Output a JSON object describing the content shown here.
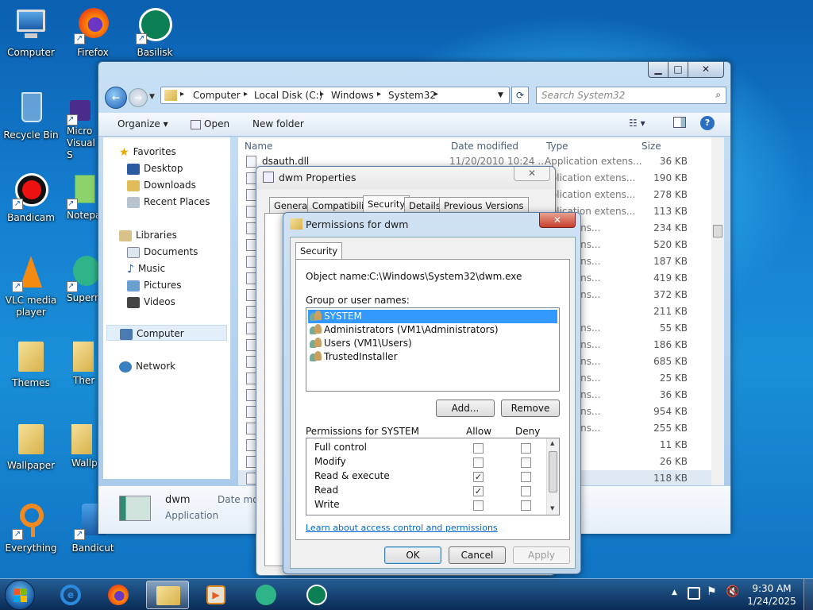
{
  "desktop": {
    "icons": [
      {
        "label": "Computer"
      },
      {
        "label": "Firefox"
      },
      {
        "label": "Basilisk"
      },
      {
        "label": "Recycle Bin"
      },
      {
        "label": "Micro Visual S"
      },
      {
        "label": "Bandicam"
      },
      {
        "label": "Notepa"
      },
      {
        "label": "VLC media player"
      },
      {
        "label": "Supern"
      },
      {
        "label": "Themes"
      },
      {
        "label": "Ther"
      },
      {
        "label": "Wallpaper"
      },
      {
        "label": "Wallp"
      },
      {
        "label": "Everything"
      },
      {
        "label": "Bandicut"
      }
    ]
  },
  "explorer": {
    "breadcrumb": [
      "Computer",
      "Local Disk (C:)",
      "Windows",
      "System32"
    ],
    "search_placeholder": "Search System32",
    "toolbar": {
      "organize": "Organize",
      "open": "Open",
      "new_folder": "New folder"
    },
    "nav": {
      "favorites": "Favorites",
      "desktop": "Desktop",
      "downloads": "Downloads",
      "recent": "Recent Places",
      "libraries": "Libraries",
      "documents": "Documents",
      "music": "Music",
      "pictures": "Pictures",
      "videos": "Videos",
      "computer": "Computer",
      "network": "Network"
    },
    "columns": {
      "name": "Name",
      "date": "Date modified",
      "type": "Type",
      "size": "Size"
    },
    "first_row": {
      "name": "dsauth.dll",
      "date": "11/20/2010 10:24 ...",
      "type": "Application extens..."
    },
    "types": [
      "Application extens...",
      "pplication extens...",
      "pplication extens...",
      "pplication extens...",
      "on extens...",
      "on extens...",
      "on extens...",
      "on extens...",
      "on extens...",
      "",
      "on extens...",
      "on extens...",
      "on extens...",
      "on extens...",
      "on extens...",
      "on extens...",
      "on extens...",
      "on",
      "on",
      "on"
    ],
    "sizes": [
      "36 KB",
      "190 KB",
      "278 KB",
      "113 KB",
      "234 KB",
      "520 KB",
      "187 KB",
      "419 KB",
      "372 KB",
      "211 KB",
      "55 KB",
      "186 KB",
      "685 KB",
      "25 KB",
      "36 KB",
      "954 KB",
      "255 KB",
      "11 KB",
      "26 KB",
      "118 KB"
    ],
    "details": {
      "name": "dwm",
      "type": "Application",
      "date_label": "Date mo"
    }
  },
  "properties": {
    "title": "dwm Properties",
    "tabs": [
      "General",
      "Compatibility",
      "Security",
      "Details",
      "Previous Versions"
    ]
  },
  "permissions": {
    "title": "Permissions for dwm",
    "tab": "Security",
    "object_label": "Object name:",
    "object_value": "C:\\Windows\\System32\\dwm.exe",
    "group_label": "Group or user names:",
    "users": [
      "SYSTEM",
      "Administrators (VM1\\Administrators)",
      "Users (VM1\\Users)",
      "TrustedInstaller"
    ],
    "add": "Add...",
    "remove": "Remove",
    "perm_label": "Permissions for SYSTEM",
    "allow": "Allow",
    "deny": "Deny",
    "perms": [
      {
        "name": "Full control",
        "allow": false,
        "deny": false
      },
      {
        "name": "Modify",
        "allow": false,
        "deny": false
      },
      {
        "name": "Read & execute",
        "allow": true,
        "deny": false
      },
      {
        "name": "Read",
        "allow": true,
        "deny": false
      },
      {
        "name": "Write",
        "allow": false,
        "deny": false
      }
    ],
    "link": "Learn about access control and permissions",
    "ok": "OK",
    "cancel": "Cancel",
    "apply": "Apply"
  },
  "taskbar": {
    "time": "9:30 AM",
    "date": "1/24/2025"
  }
}
